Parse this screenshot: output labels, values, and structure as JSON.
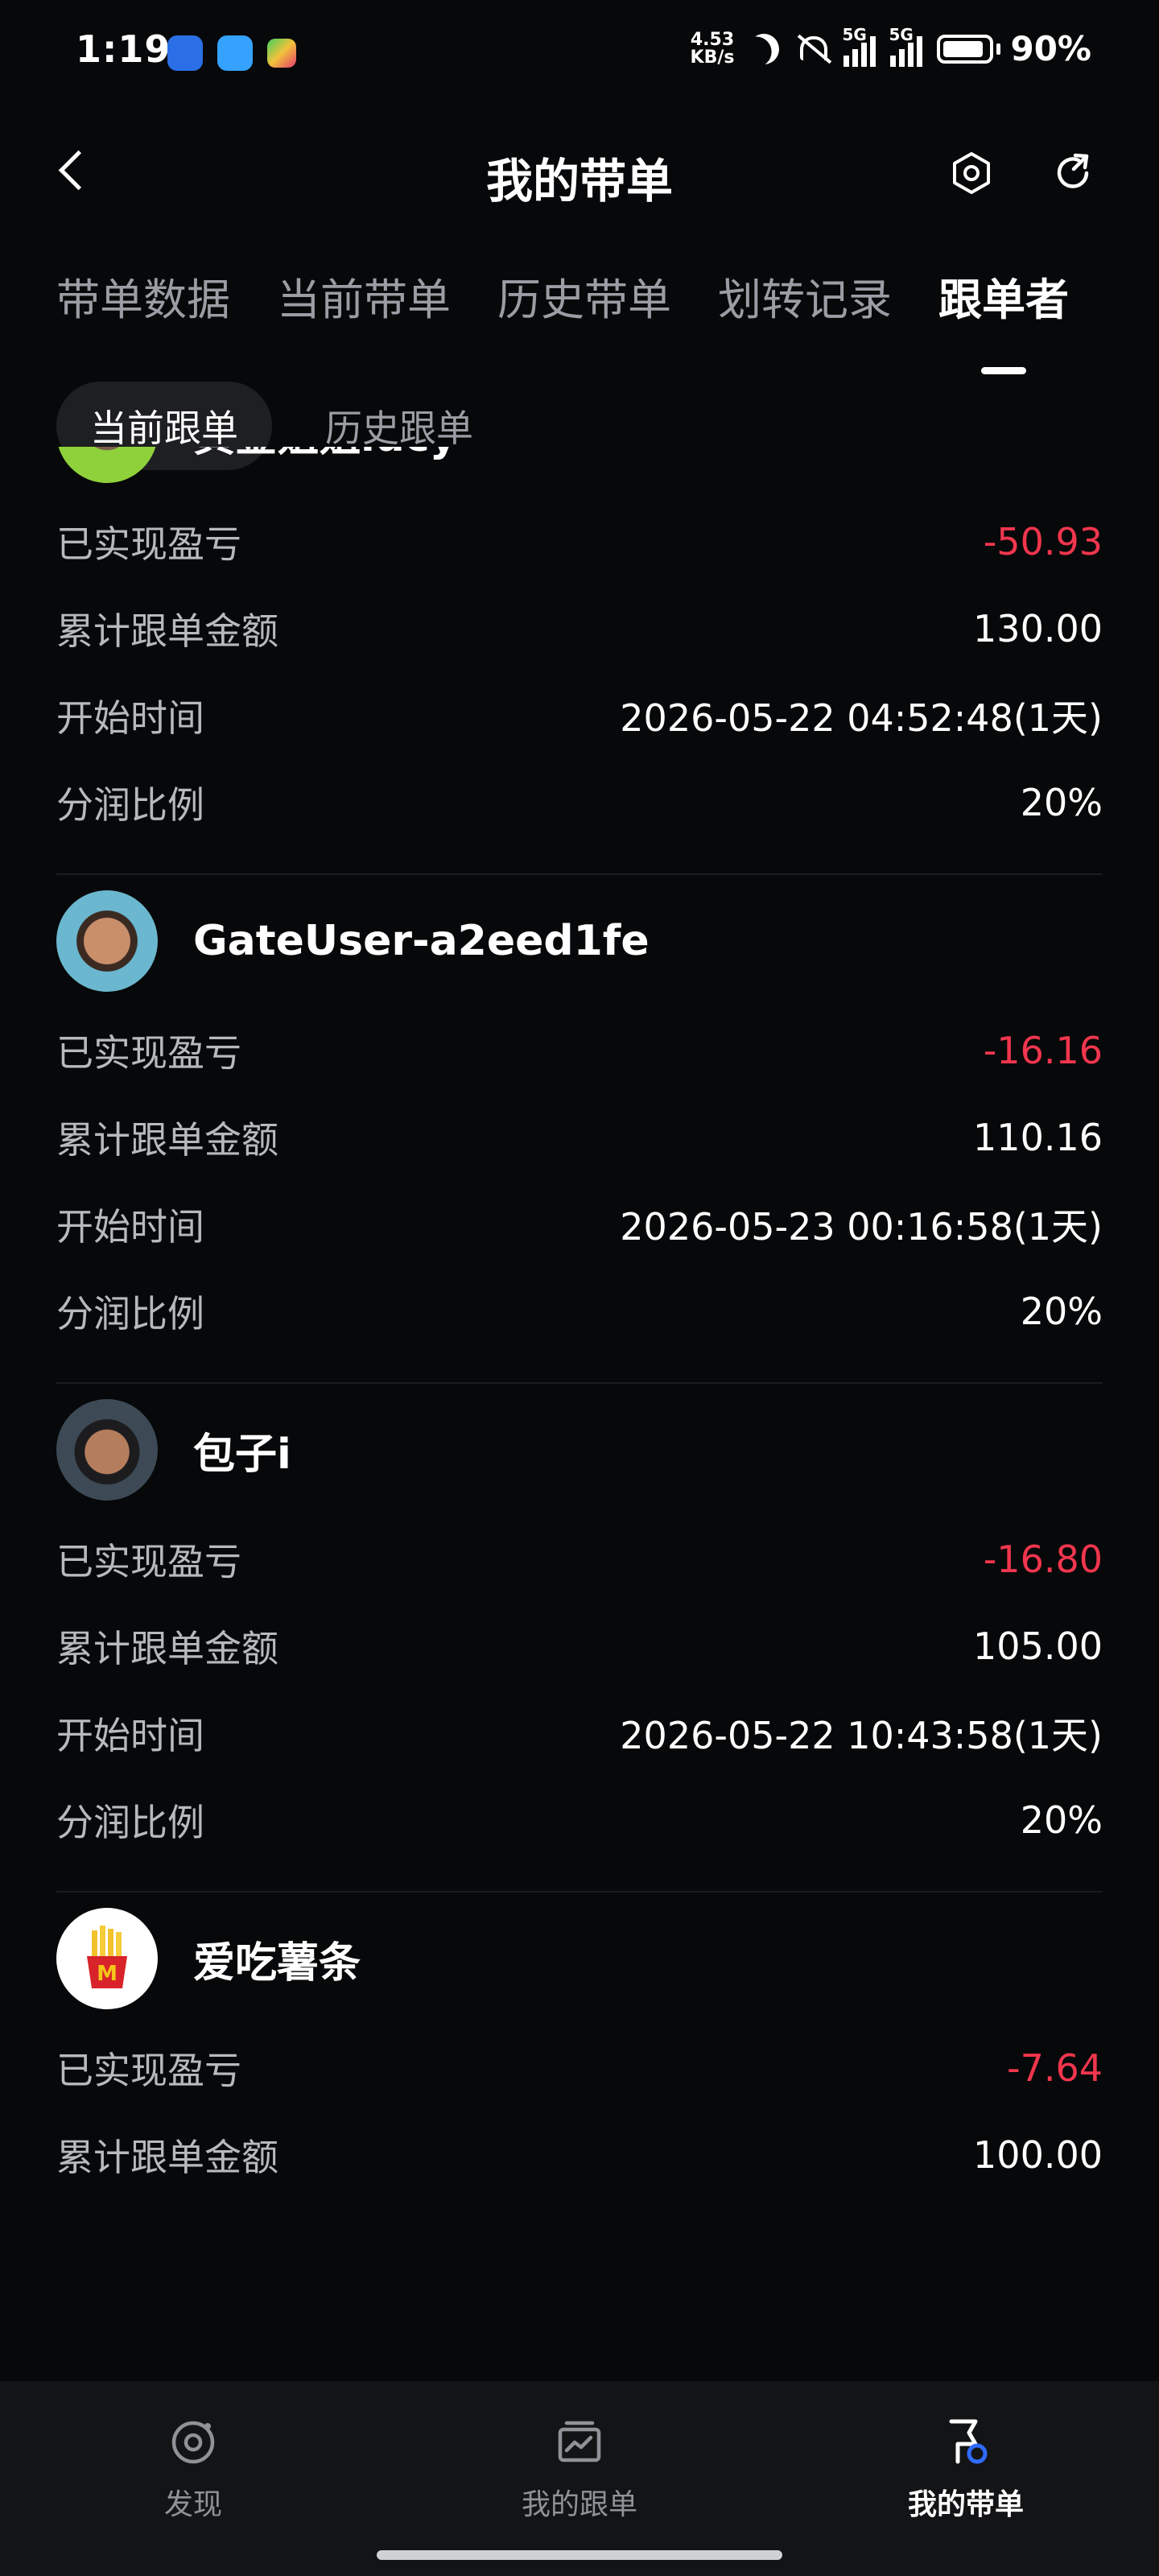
{
  "status_bar": {
    "time": "1:19",
    "net_speed_value": "4.53",
    "net_speed_unit": "KB/s",
    "sim1_label": "5G",
    "sim2_label": "5G",
    "battery": "90%"
  },
  "header": {
    "title": "我的带单"
  },
  "tabs": [
    {
      "label": "带单数据"
    },
    {
      "label": "当前带单"
    },
    {
      "label": "历史带单"
    },
    {
      "label": "划转记录"
    },
    {
      "label": "跟单者"
    }
  ],
  "subtabs": [
    {
      "label": "当前跟单"
    },
    {
      "label": "历史跟单"
    }
  ],
  "row_labels": {
    "pnl": "已实现盈亏",
    "amount": "累计跟单金额",
    "start": "开始时间",
    "share": "分润比例"
  },
  "followers": [
    {
      "name": "黄金姐姐lucy",
      "pnl": "-50.93",
      "amount": "130.00",
      "start": "2026-05-22 04:52:48(1天)",
      "share": "20%"
    },
    {
      "name": "GateUser-a2eed1fe",
      "pnl": "-16.16",
      "amount": "110.16",
      "start": "2026-05-23 00:16:58(1天)",
      "share": "20%"
    },
    {
      "name": "包子i",
      "pnl": "-16.80",
      "amount": "105.00",
      "start": "2026-05-22 10:43:58(1天)",
      "share": "20%"
    },
    {
      "name": "爱吃薯条",
      "pnl": "-7.64",
      "amount": "100.00"
    }
  ],
  "bottom_nav": [
    {
      "label": "发现"
    },
    {
      "label": "我的跟单"
    },
    {
      "label": "我的带单"
    }
  ],
  "colors": {
    "background": "#070809",
    "negative": "#f1364e",
    "accent_blue": "#2f6bff"
  }
}
